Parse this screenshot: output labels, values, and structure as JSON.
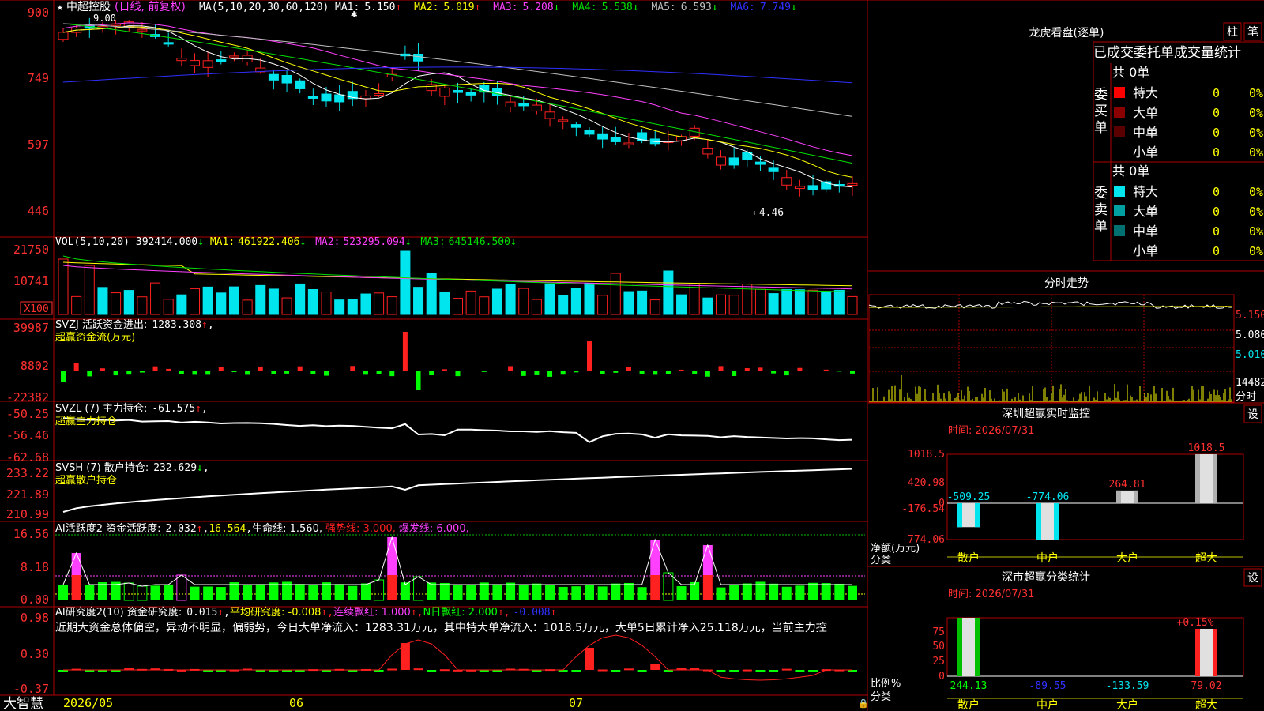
{
  "colors": {
    "up": "#ff2020",
    "down": "#00e5ee",
    "frame": "#b00000",
    "ma1": "#ffffff",
    "ma2": "#ffff00",
    "ma3": "#ff40ff",
    "ma4": "#00e000",
    "ma5": "#c0c0c0",
    "ma6": "#3030ff",
    "yellow": "#ffff00",
    "green": "#00ff00",
    "magenta": "#ff40ff"
  },
  "header": {
    "stock": "中超控股",
    "mode": "(日线, 前复权)",
    "ma_params": "MA(5,10,20,30,60,120)",
    "ma": [
      {
        "name": "MA1:",
        "value": "5.150",
        "dir": "↑"
      },
      {
        "name": "MA2:",
        "value": "5.019",
        "dir": "↑"
      },
      {
        "name": "MA3:",
        "value": "5.208",
        "dir": "↓"
      },
      {
        "name": "MA4:",
        "value": "5.538",
        "dir": "↓"
      },
      {
        "name": "MA5:",
        "value": "6.593",
        "dir": "↓"
      },
      {
        "name": "MA6:",
        "value": "7.749",
        "dir": "↓"
      }
    ]
  },
  "price_axis": {
    "ticks": [
      "900",
      "749",
      "597",
      "446"
    ],
    "high_label": "9.00",
    "low_label": "←4.46"
  },
  "vol_panel": {
    "title": "VOL(5,10,20)",
    "value": "392414.000",
    "dir": "↓",
    "ma": [
      {
        "name": "MA1:",
        "value": "461922.406",
        "dir": "↓"
      },
      {
        "name": "MA2:",
        "value": "523295.094",
        "dir": "↓"
      },
      {
        "name": "MA3:",
        "value": "645146.500",
        "dir": "↓"
      }
    ],
    "ticks": [
      "21750",
      "10741"
    ],
    "unit": "X100"
  },
  "svzj_panel": {
    "title": "SVZJ  活跃资金进出:",
    "value": "1283.308",
    "dir": "↑",
    "sub": "超赢资金流(万元)",
    "ticks": [
      "39987",
      "8802",
      "-22382"
    ]
  },
  "svzl_panel": {
    "title": "SVZL (7) 主力持仓:",
    "value": "-61.575",
    "dir": "↑",
    "sub": "超赢主力持仓",
    "ticks": [
      "-50.25",
      "-56.46",
      "-62.68"
    ]
  },
  "svsh_panel": {
    "title": "SVSH (7) 散户持仓:",
    "value": "232.629",
    "dir": "↓",
    "sub": "超赢散户持仓",
    "ticks": [
      "233.22",
      "221.89",
      "210.99"
    ]
  },
  "active_panel": {
    "title": "AI活跃度2 资金活跃度:",
    "value": "2.032",
    "dir": "↑",
    "v2": "16.564",
    "life": "生命线: 1.560,",
    "strong": "强势线: 3.000,",
    "burst": "爆发线: 6.000,",
    "ticks": [
      "16.56",
      "8.18",
      "0.00"
    ]
  },
  "research_panel": {
    "title": "AI研究度2(10) 资金研究度:",
    "value": "0.015",
    "dir": "↑",
    "avg": "平均研究度: -0.008",
    "red": "连续飘红: 1.000",
    "nred": "N日飘红: 2.000",
    "last": "-0.008",
    "ticks": [
      "0.98",
      "0.30",
      "-0.37"
    ],
    "summary": "近期大资金总体偏空，异动不明显，偏弱势，今日大单净流入：1283.31万元，其中特大单净流入：1018.5万元，大单5日累计净入25.118万元，当前主力控"
  },
  "dates": [
    "2026/05",
    "06",
    "07"
  ],
  "brand": "大智慧",
  "right_panel": {
    "lhb_title": "龙虎看盘(逐单)",
    "btn_zhu": "柱",
    "btn_bi": "笔",
    "order_header": "已成交委托单成交量统计",
    "buy_label": "委买单",
    "sell_label": "委卖单",
    "buy": {
      "total": "共 0单",
      "rows": [
        {
          "name": "特大",
          "v": "0",
          "p": "0%",
          "c": "#ff0000"
        },
        {
          "name": "大单",
          "v": "0",
          "p": "0%",
          "c": "#8b0000"
        },
        {
          "name": "中单",
          "v": "0",
          "p": "0%",
          "c": "#5a0000"
        },
        {
          "name": "小单",
          "v": "0",
          "p": "0%",
          "c": ""
        }
      ]
    },
    "sell": {
      "total": "共 0单",
      "rows": [
        {
          "name": "特大",
          "v": "0",
          "p": "0%",
          "c": "#00e5ee"
        },
        {
          "name": "大单",
          "v": "0",
          "p": "0%",
          "c": "#00a0a0"
        },
        {
          "name": "中单",
          "v": "0",
          "p": "0%",
          "c": "#007070"
        },
        {
          "name": "小单",
          "v": "0",
          "p": "0%",
          "c": ""
        }
      ]
    },
    "fs_title": "分时走势",
    "fs_ticks": [
      "5.150",
      "5.080",
      "5.010"
    ],
    "fs_vol": "14482",
    "fs_unit": "分时",
    "sz_title": "深圳超赢实时监控",
    "sz_btn": "设",
    "sz_time": "时间: 2026/07/31",
    "sz_ticks": [
      "1018.5",
      "420.98",
      "0",
      "-176.54",
      "-774.06"
    ],
    "sz_ylabel": "净额(万元)",
    "sz_xlabel": "分类",
    "sf_title": "深市超赢分类统计",
    "sf_btn": "设",
    "sf_time": "时间: 2026/07/31",
    "sf_ticks": [
      "75",
      "50",
      "25",
      "0"
    ],
    "sf_ylabel": "比例%",
    "sf_xlabel": "分类",
    "sf_top": "+0.15%"
  },
  "chart_data": [
    {
      "type": "bar",
      "title": "深圳超赢实时监控",
      "categories": [
        "散户",
        "中户",
        "大户",
        "超大"
      ],
      "values": [
        -509.25,
        -774.06,
        264.81,
        1018.5
      ],
      "ylim": [
        -774.06,
        1018.5
      ],
      "ylabel": "净额(万元)",
      "xlabel": "分类"
    },
    {
      "type": "bar",
      "title": "深市超赢分类统计",
      "categories": [
        "散户",
        "中户",
        "大户",
        "超大"
      ],
      "values": [
        244.13,
        -89.55,
        -133.59,
        79.02
      ],
      "ylabel": "比例%",
      "xlabel": "分类"
    }
  ]
}
